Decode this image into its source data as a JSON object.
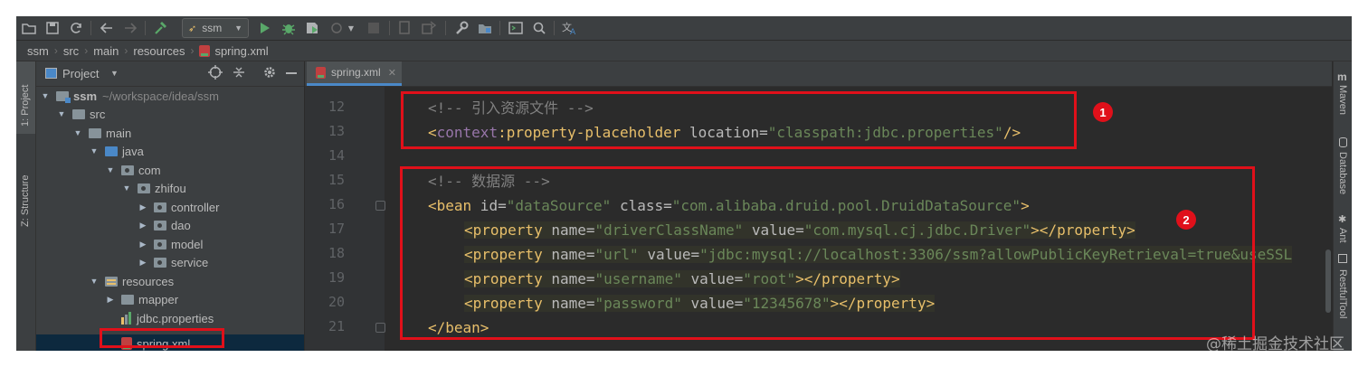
{
  "toolbar": {
    "run_config": "ssm",
    "icons": [
      "folder-open-icon",
      "save-icon",
      "sync-icon",
      "back-arrow-icon",
      "forward-arrow-icon",
      "build-hammer-icon",
      "run-icon",
      "debug-icon",
      "coverage-icon",
      "profile-icon",
      "stop-icon",
      "structure-icon",
      "deploy-icon",
      "wrench-icon",
      "project-structure-icon",
      "terminal-icon",
      "search-icon",
      "translate-icon"
    ]
  },
  "breadcrumb": [
    "ssm",
    "src",
    "main",
    "resources",
    "spring.xml"
  ],
  "left_strip": {
    "project_label": "1: Project",
    "structure_label": "Z: Structure"
  },
  "project_panel": {
    "title": "Project",
    "tree": [
      {
        "name": "ssm",
        "extra": "~/workspace/idea/ssm",
        "icon": "module"
      },
      {
        "name": "src",
        "icon": "folder"
      },
      {
        "name": "main",
        "icon": "folder"
      },
      {
        "name": "java",
        "icon": "source-folder"
      },
      {
        "name": "com",
        "icon": "package"
      },
      {
        "name": "zhifou",
        "icon": "package"
      },
      {
        "name": "controller",
        "icon": "package"
      },
      {
        "name": "dao",
        "icon": "package"
      },
      {
        "name": "model",
        "icon": "package"
      },
      {
        "name": "service",
        "icon": "package"
      },
      {
        "name": "resources",
        "icon": "resources-folder"
      },
      {
        "name": "mapper",
        "icon": "folder"
      },
      {
        "name": "jdbc.properties",
        "icon": "properties-file"
      },
      {
        "name": "spring.xml",
        "icon": "xml-file"
      }
    ]
  },
  "editor": {
    "tab_label": "spring.xml",
    "line_numbers": [
      "12",
      "13",
      "14",
      "15",
      "16",
      "17",
      "18",
      "19",
      "20",
      "21"
    ],
    "code": {
      "l12": "<!-- 引入资源文件 -->",
      "l13_open": "<",
      "l13_ns": "context",
      "l13_tag": ":property-placeholder",
      "l13_attr": " location",
      "l13_eq": "=",
      "l13_val": "\"classpath:jdbc.properties\"",
      "l13_close": "/>",
      "l15": "<!-- 数据源 -->",
      "l16_tag": "<bean",
      "l16_a1": " id",
      "l16_v1": "\"dataSource\"",
      "l16_a2": " class",
      "l16_v2": "\"com.alibaba.druid.pool.DruidDataSource\"",
      "l16_close": ">",
      "prop_open": "<property",
      "prop_close": "></property>",
      "attr_name": " name",
      "attr_value": " value",
      "eq": "=",
      "l17_name": "\"driverClassName\"",
      "l17_value": "\"com.mysql.cj.jdbc.Driver\"",
      "l18_name": "\"url\"",
      "l18_value": "\"jdbc:mysql://localhost:3306/ssm?allowPublicKeyRetrieval=true&useSSL",
      "l19_name": "\"username\"",
      "l19_value": "\"root\"",
      "l20_name": "\"password\"",
      "l20_value": "\"12345678\"",
      "l21": "</bean>"
    }
  },
  "right_strip": [
    "Maven",
    "Database",
    "Ant",
    "RestfulTool"
  ],
  "annotations": [
    "1",
    "2"
  ],
  "watermark": "@稀土掘金技术社区",
  "colors": {
    "accent": "#4a88c7",
    "annotation": "#e0101a",
    "tag": "#e8bf6a",
    "string": "#6a8759",
    "comment": "#808080",
    "namespace": "#9876aa"
  }
}
